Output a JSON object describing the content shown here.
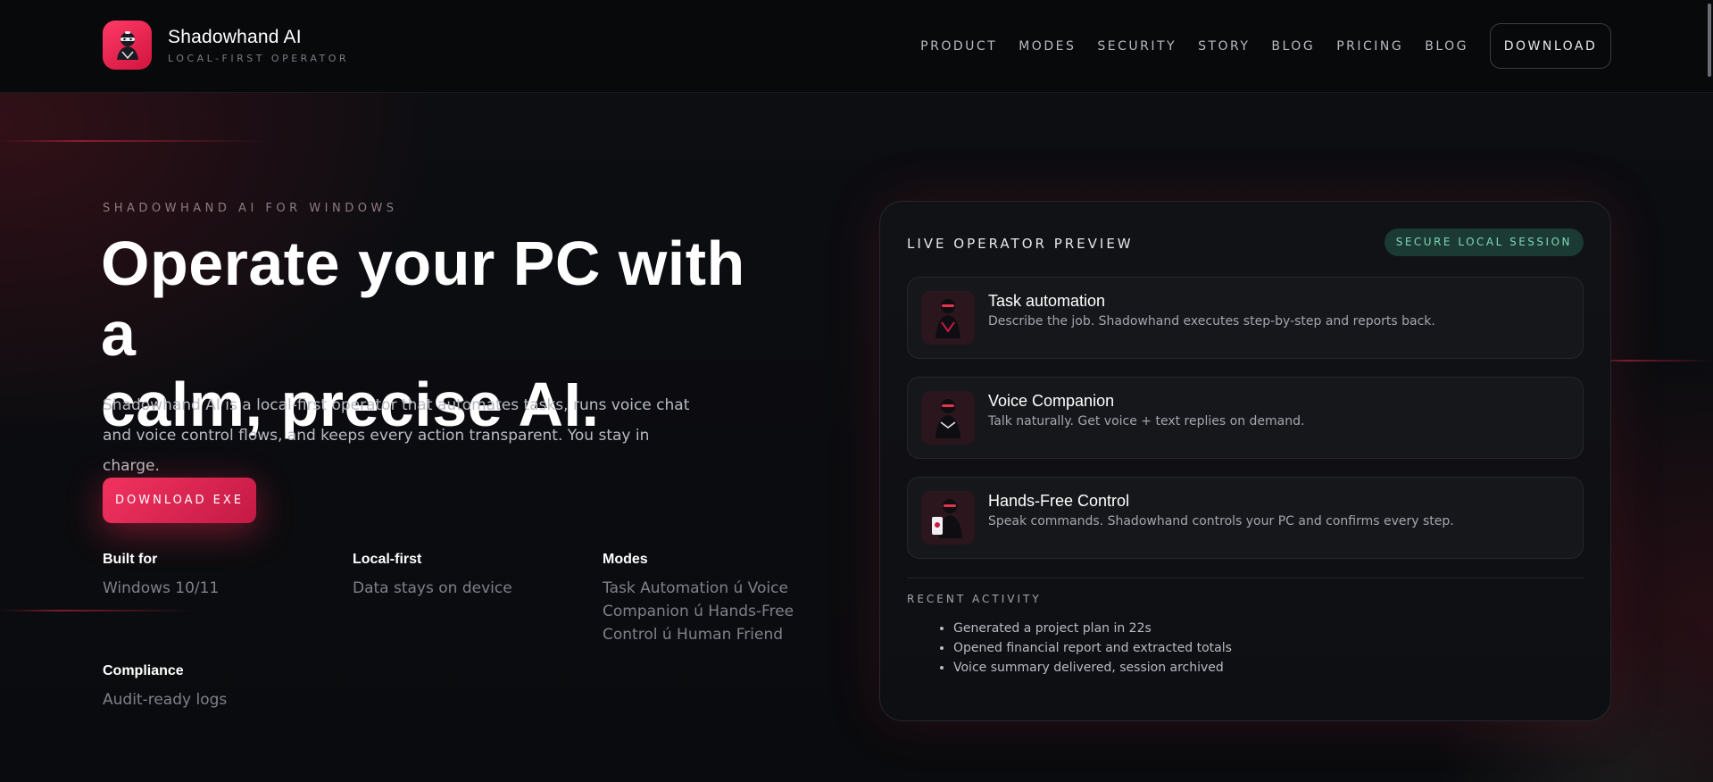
{
  "brand": {
    "name": "Shadowhand AI",
    "tagline": "LOCAL-FIRST OPERATOR"
  },
  "nav": {
    "links": [
      "PRODUCT",
      "MODES",
      "SECURITY",
      "STORY",
      "BLOG",
      "PRICING",
      "BLOG"
    ],
    "download_label": "DOWNLOAD"
  },
  "hero": {
    "eyebrow": "SHADOWHAND AI FOR WINDOWS",
    "title_line1": "Operate your PC with a",
    "title_line2": "calm, precise AI.",
    "lede_line1": "Shadowhand AI is a local-first operator that automates tasks, runs voice chat",
    "lede_line2": "and voice control flows, and keeps every action transparent. You stay in charge.",
    "cta_label": "DOWNLOAD EXE"
  },
  "facts": [
    {
      "label": "Built for",
      "value": "Windows 10/11"
    },
    {
      "label": "Local-first",
      "value": "Data stays on device"
    },
    {
      "label": "Modes",
      "value_lines": [
        "Task Automation ú Voice",
        "Companion ú Hands-Free",
        "Control ú Human Friend"
      ]
    },
    {
      "label": "Compliance",
      "value": "Audit-ready logs"
    }
  ],
  "preview": {
    "title": "LIVE OPERATOR PREVIEW",
    "badge": "SECURE LOCAL SESSION",
    "modes": [
      {
        "title": "Task automation",
        "desc": "Describe the job. Shadowhand executes step-by-step and reports back.",
        "icon": "ninja-avatar-icon"
      },
      {
        "title": "Voice Companion",
        "desc": "Talk naturally. Get voice + text replies on demand.",
        "icon": "ninja-avatar-icon"
      },
      {
        "title": "Hands-Free Control",
        "desc": "Speak commands. Shadowhand controls your PC and confirms every step.",
        "icon": "ninja-avatar-icon"
      }
    ],
    "recent_title": "RECENT ACTIVITY",
    "activity": [
      "Generated a project plan in 22s",
      "Opened financial report and extracted totals",
      "Voice summary delivered, session archived"
    ]
  },
  "colors": {
    "accent": "#f2325f",
    "badge_bg": "#1b3a33",
    "badge_text": "#7fd6b8",
    "background": "#0b0c0f"
  }
}
